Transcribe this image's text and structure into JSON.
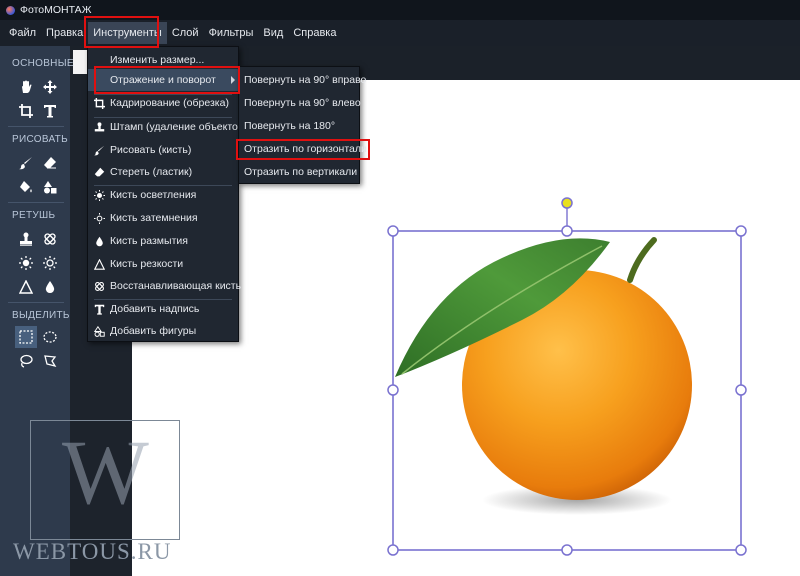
{
  "app": {
    "title": "ФотоМОНТАЖ"
  },
  "menubar": {
    "items": [
      "Файл",
      "Правка",
      "Инструменты",
      "Слой",
      "Фильтры",
      "Вид",
      "Справка"
    ],
    "active": "Инструменты"
  },
  "toolpanel": {
    "sections": {
      "basic": "ОСНОВНЫЕ",
      "draw": "РИСОВАТЬ",
      "retouch": "РЕТУШЬ",
      "select": "ВЫДЕЛИТЬ"
    },
    "tools": {
      "basic": [
        "hand-icon",
        "move-icon",
        "crop-icon",
        "text-icon"
      ],
      "draw": [
        "brush-icon",
        "eraser-icon",
        "fill-bucket-icon",
        "shapes-icon"
      ],
      "retouch": [
        "stamp-icon",
        "healing-patch-icon",
        "lighten-icon",
        "darken-icon",
        "sharpen-icon",
        "blur-drop-icon"
      ],
      "select": [
        "rect-select-icon",
        "ellipse-select-icon",
        "lasso-icon",
        "polygon-lasso-icon"
      ]
    }
  },
  "dropdown": {
    "items": [
      {
        "label": "Изменить размер...",
        "icon": ""
      },
      {
        "label": "Отражение и поворот",
        "icon": "",
        "submenu": true
      },
      {
        "label": "Кадрирование (обрезка)",
        "icon": "crop-icon"
      },
      {
        "label": "Штамп (удаление объектов)",
        "icon": "stamp-icon"
      },
      {
        "label": "Рисовать (кисть)",
        "icon": "brush-icon"
      },
      {
        "label": "Стереть (ластик)",
        "icon": "eraser-icon"
      },
      {
        "label": "Кисть осветления",
        "icon": "sun-icon"
      },
      {
        "label": "Кисть затемнения",
        "icon": "sun-outline-icon"
      },
      {
        "label": "Кисть размытия",
        "icon": "drop-icon"
      },
      {
        "label": "Кисть резкости",
        "icon": "triangle-icon"
      },
      {
        "label": "Восстанавливающая кисть",
        "icon": "patch-icon"
      },
      {
        "label": "Добавить надпись",
        "icon": "text-icon"
      },
      {
        "label": "Добавить фигуры",
        "icon": "shapes-icon"
      }
    ]
  },
  "submenu": {
    "items": [
      "Повернуть на 90° вправо",
      "Повернуть на 90° влево",
      "Повернуть на 180°",
      "Отразить по горизонтали",
      "Отразить по вертикали"
    ]
  },
  "watermark": {
    "text": "WEBTOUS.RU",
    "letter": "W"
  },
  "colors": {
    "highlight": "#e01010",
    "selection": "#7a72d0",
    "rotate_handle": "#e8e020",
    "orange": "#f5951a",
    "leaf": "#3d8a2e"
  }
}
